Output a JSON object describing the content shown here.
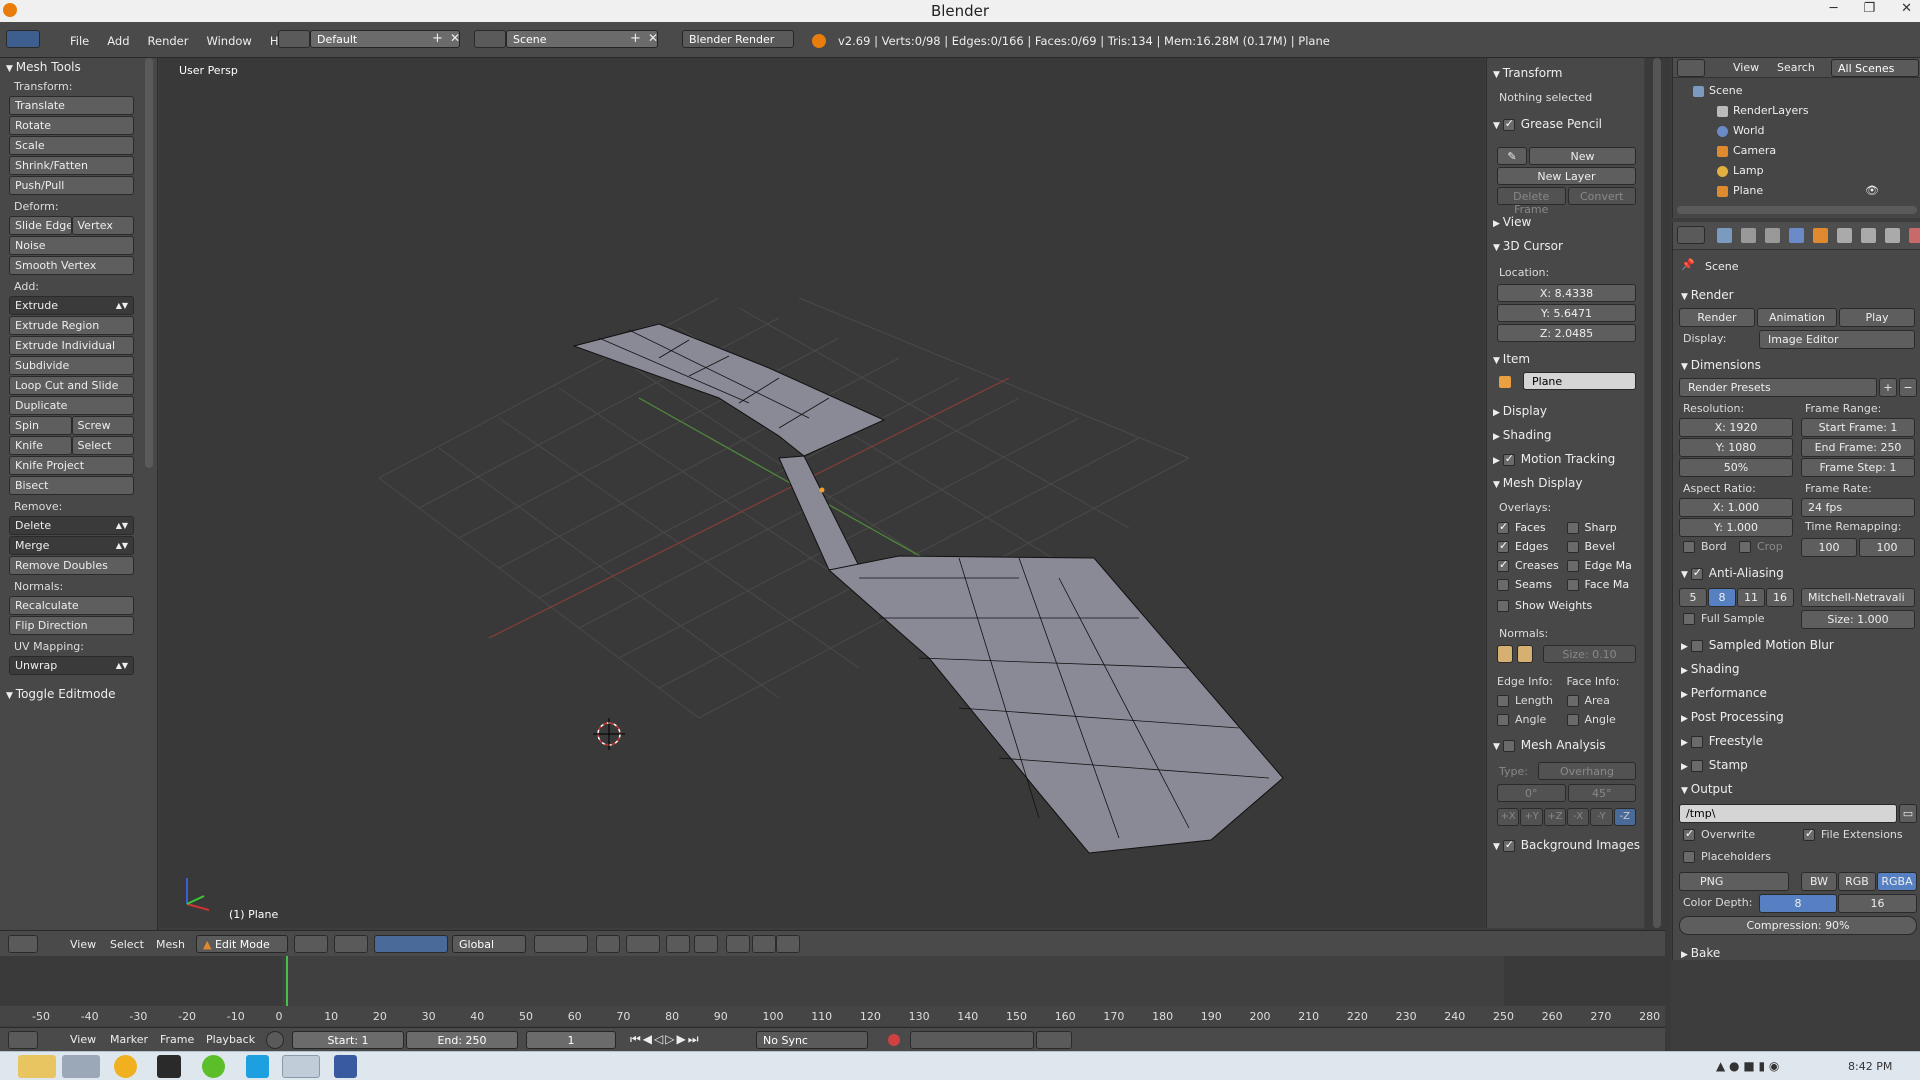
{
  "window": {
    "title": "Blender"
  },
  "topbar": {
    "menus": [
      "File",
      "Add",
      "Render",
      "Window",
      "Help"
    ],
    "layout": "Default",
    "scene": "Scene",
    "engine": "Blender Render",
    "stats": "v2.69 | Verts:0/98 | Edges:0/166 | Faces:0/69 | Tris:134 | Mem:16.28M (0.17M) | Plane"
  },
  "toolshelf": {
    "title": "Mesh Tools",
    "transform_label": "Transform:",
    "transform": [
      "Translate",
      "Rotate",
      "Scale",
      "Shrink/Fatten",
      "Push/Pull"
    ],
    "deform_label": "Deform:",
    "slide_edge": "Slide Edge",
    "vertex": "Vertex",
    "noise": "Noise",
    "smooth_vertex": "Smooth Vertex",
    "add_label": "Add:",
    "extrude": "Extrude",
    "add": [
      "Extrude Region",
      "Extrude Individual",
      "Subdivide",
      "Loop Cut and Slide",
      "Duplicate"
    ],
    "spin": "Spin",
    "screw": "Screw",
    "knife": "Knife",
    "select": "Select",
    "knife_project": "Knife Project",
    "bisect": "Bisect",
    "remove_label": "Remove:",
    "delete": "Delete",
    "merge": "Merge",
    "remove_doubles": "Remove Doubles",
    "normals_label": "Normals:",
    "recalculate": "Recalculate",
    "flip_direction": "Flip Direction",
    "uv_label": "UV Mapping:",
    "unwrap": "Unwrap",
    "toggle_editmode": "Toggle Editmode"
  },
  "viewport": {
    "persp_label": "User Persp",
    "object_label": "(1) Plane"
  },
  "npanel": {
    "transform": "Transform",
    "nothing_selected": "Nothing selected",
    "grease_pencil": "Grease Pencil",
    "new": "New",
    "new_layer": "New Layer",
    "delete_frame": "Delete Frame",
    "convert": "Convert",
    "view": "View",
    "cursor": "3D Cursor",
    "location": "Location:",
    "x": "X: 8.4338",
    "y": "Y: 5.6471",
    "z": "Z: 2.0485",
    "item": "Item",
    "item_name": "Plane",
    "display": "Display",
    "shading": "Shading",
    "motion_tracking": "Motion Tracking",
    "mesh_display": "Mesh Display",
    "overlays": "Overlays:",
    "faces": "Faces",
    "sharp": "Sharp",
    "edges": "Edges",
    "bevel": "Bevel",
    "creases": "Creases",
    "edge_ma": "Edge Ma",
    "seams": "Seams",
    "face_ma": "Face Ma",
    "show_weights": "Show Weights",
    "normals": "Normals:",
    "size": "Size: 0.10",
    "edge_info": "Edge Info:",
    "face_info": "Face Info:",
    "length": "Length",
    "area": "Area",
    "angle": "Angle",
    "angle2": "Angle",
    "mesh_analysis": "Mesh Analysis",
    "type_label": "Type:",
    "type_value": "Overhang",
    "min": "0°",
    "max": "45°",
    "axes": [
      "+X",
      "+Y",
      "+Z",
      "-X",
      "-Y",
      "-Z"
    ],
    "background_images": "Background Images"
  },
  "outliner": {
    "view": "View",
    "search": "Search",
    "all_scenes": "All Scenes",
    "items": [
      "Scene",
      "RenderLayers",
      "World",
      "Camera",
      "Lamp",
      "Plane"
    ]
  },
  "props": {
    "scene": "Scene",
    "render": "Render",
    "render_btn": "Render",
    "animation_btn": "Animation",
    "play_btn": "Play",
    "display_label": "Display:",
    "display_value": "Image Editor",
    "dimensions": "Dimensions",
    "render_presets": "Render Presets",
    "resolution": "Resolution:",
    "frame_range": "Frame Range:",
    "res_x": "X: 1920",
    "res_y": "Y: 1080",
    "res_pct": "50%",
    "start_frame": "Start Frame: 1",
    "end_frame": "End Frame: 250",
    "frame_step": "Frame Step: 1",
    "aspect": "Aspect Ratio:",
    "frame_rate": "Frame Rate:",
    "asp_x": "X: 1.000",
    "asp_y": "Y: 1.000",
    "fps": "24 fps",
    "time_remap": "Time Remapping:",
    "remap_old": "100",
    "remap_new": "100",
    "bord": "Bord",
    "crop": "Crop",
    "anti_aliasing": "Anti-Aliasing",
    "aa_levels": [
      "5",
      "8",
      "11",
      "16"
    ],
    "aa_filter": "Mitchell-Netravali",
    "full_sample": "Full Sample",
    "aa_size": "Size: 1.000",
    "sampled_motion_blur": "Sampled Motion Blur",
    "shading": "Shading",
    "performance": "Performance",
    "post_processing": "Post Processing",
    "freestyle": "Freestyle",
    "stamp": "Stamp",
    "output": "Output",
    "output_path": "/tmp\\",
    "overwrite": "Overwrite",
    "file_extensions": "File Extensions",
    "placeholders": "Placeholders",
    "format": "PNG",
    "bw": "BW",
    "rgb": "RGB",
    "rgba": "RGBA",
    "color_depth": "Color Depth:",
    "depth_8": "8",
    "depth_16": "16",
    "compression": "Compression: 90%",
    "bake": "Bake"
  },
  "vphdr": {
    "menus": [
      "View",
      "Select",
      "Mesh"
    ],
    "mode": "Edit Mode",
    "orientation": "Global"
  },
  "timeline": {
    "ticks": [
      "-50",
      "-40",
      "-30",
      "-20",
      "-10",
      "0",
      "10",
      "20",
      "30",
      "40",
      "50",
      "60",
      "70",
      "80",
      "90",
      "100",
      "110",
      "120",
      "130",
      "140",
      "150",
      "160",
      "170",
      "180",
      "190",
      "200",
      "210",
      "220",
      "230",
      "240",
      "250",
      "260",
      "270",
      "280"
    ],
    "menus": [
      "View",
      "Marker",
      "Frame",
      "Playback"
    ],
    "start": "Start: 1",
    "end": "End: 250",
    "current": "1",
    "sync": "No Sync"
  },
  "taskbar": {
    "clock": "8:42 PM"
  },
  "colors": {
    "accent": "#5680c2",
    "mesh": "#8a8a97",
    "blender_orange": "#e87d0d"
  }
}
